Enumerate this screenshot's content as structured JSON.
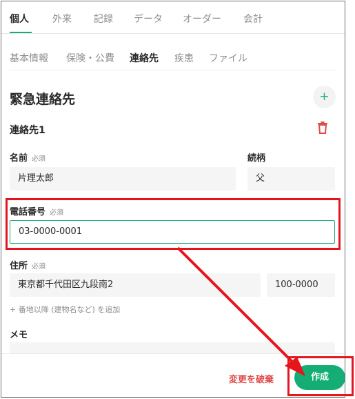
{
  "top_tabs": [
    "個人",
    "外来",
    "記録",
    "データ",
    "オーダー",
    "会計"
  ],
  "sub_tabs": [
    "基本情報",
    "保険・公費",
    "連絡先",
    "疾患",
    "ファイル"
  ],
  "section_title": "緊急連絡先",
  "add_label": "+",
  "contact_title": "連絡先1",
  "required_tag": "必須",
  "name": {
    "label": "名前",
    "value": "片理太郎"
  },
  "relation": {
    "label": "続柄",
    "value": "父"
  },
  "phone": {
    "label": "電話番号",
    "value": "03-0000-0001"
  },
  "address": {
    "label": "住所",
    "value": "東京都千代田区九段南2",
    "postal": "100-0000"
  },
  "add_address_link": "+ 番地以降 (建物名など) を追加",
  "memo_label": "メモ",
  "footer": {
    "discard_label": "変更を破棄",
    "create_label": "作成"
  },
  "colors": {
    "accent": "#14ad74",
    "danger": "#e04a4a",
    "annotation": "#e5151d"
  }
}
